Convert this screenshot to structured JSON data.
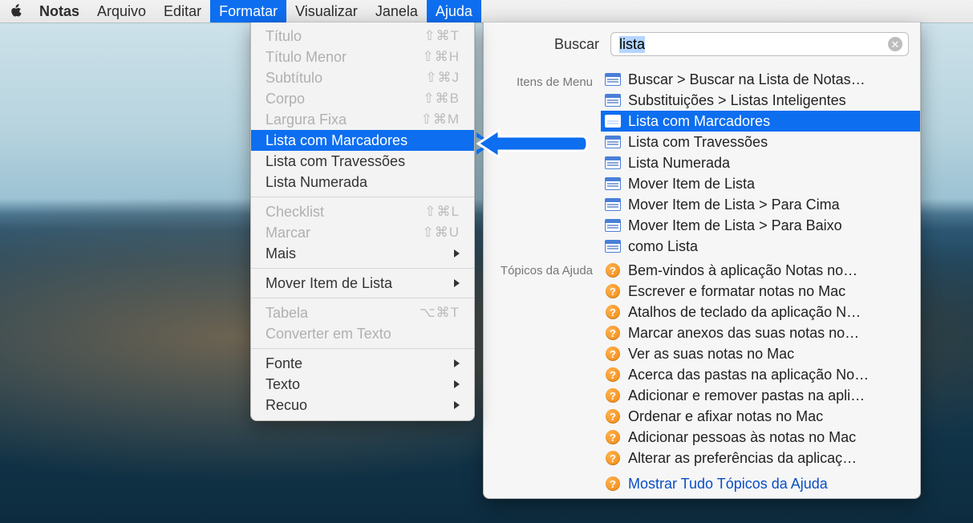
{
  "menubar": {
    "app": "Notas",
    "items": [
      "Arquivo",
      "Editar",
      "Formatar",
      "Visualizar",
      "Janela",
      "Ajuda"
    ],
    "selected": [
      "Formatar",
      "Ajuda"
    ]
  },
  "formatar_menu": {
    "rows": [
      {
        "label": "Título",
        "shortcut": "⇧⌘T",
        "disabled": true
      },
      {
        "label": "Título Menor",
        "shortcut": "⇧⌘H",
        "disabled": true
      },
      {
        "label": "Subtítulo",
        "shortcut": "⇧⌘J",
        "disabled": true
      },
      {
        "label": "Corpo",
        "shortcut": "⇧⌘B",
        "disabled": true
      },
      {
        "label": "Largura Fixa",
        "shortcut": "⇧⌘M",
        "disabled": true
      },
      {
        "label": "Lista com Marcadores",
        "selected": true
      },
      {
        "label": "Lista com Travessões"
      },
      {
        "label": "Lista Numerada"
      },
      {
        "sep": true
      },
      {
        "label": "Checklist",
        "shortcut": "⇧⌘L",
        "disabled": true
      },
      {
        "label": "Marcar",
        "shortcut": "⇧⌘U",
        "disabled": true
      },
      {
        "label": "Mais",
        "submenu": true
      },
      {
        "sep": true
      },
      {
        "label": "Mover Item de Lista",
        "submenu": true
      },
      {
        "sep": true
      },
      {
        "label": "Tabela",
        "shortcut": "⌥⌘T",
        "disabled": true
      },
      {
        "label": "Converter em Texto",
        "disabled": true
      },
      {
        "sep": true
      },
      {
        "label": "Fonte",
        "submenu": true
      },
      {
        "label": "Texto",
        "submenu": true
      },
      {
        "label": "Recuo",
        "submenu": true
      }
    ]
  },
  "help_panel": {
    "search_label": "Buscar",
    "search_value": "lista",
    "section_menu": "Itens de Menu",
    "section_help": "Tópicos da Ajuda",
    "menu_results": [
      {
        "label": "Buscar > Buscar na Lista de Notas…"
      },
      {
        "label": "Substituições > Listas Inteligentes"
      },
      {
        "label": "Lista com Marcadores",
        "selected": true
      },
      {
        "label": "Lista com Travessões"
      },
      {
        "label": "Lista Numerada"
      },
      {
        "label": "Mover Item de Lista"
      },
      {
        "label": "Mover Item de Lista > Para Cima"
      },
      {
        "label": "Mover Item de Lista > Para Baixo"
      },
      {
        "label": "como Lista"
      }
    ],
    "help_results": [
      "Bem-vindos à aplicação Notas no…",
      "Escrever e formatar notas no Mac",
      "Atalhos de teclado da aplicação N…",
      "Marcar anexos das suas notas no…",
      "Ver as suas notas no Mac",
      "Acerca das pastas na aplicação No…",
      "Adicionar e remover pastas na apli…",
      "Ordenar e afixar notas no Mac",
      "Adicionar pessoas às notas no Mac",
      "Alterar as preferências da aplicaç…"
    ],
    "show_all": "Mostrar Tudo Tópicos da Ajuda"
  }
}
